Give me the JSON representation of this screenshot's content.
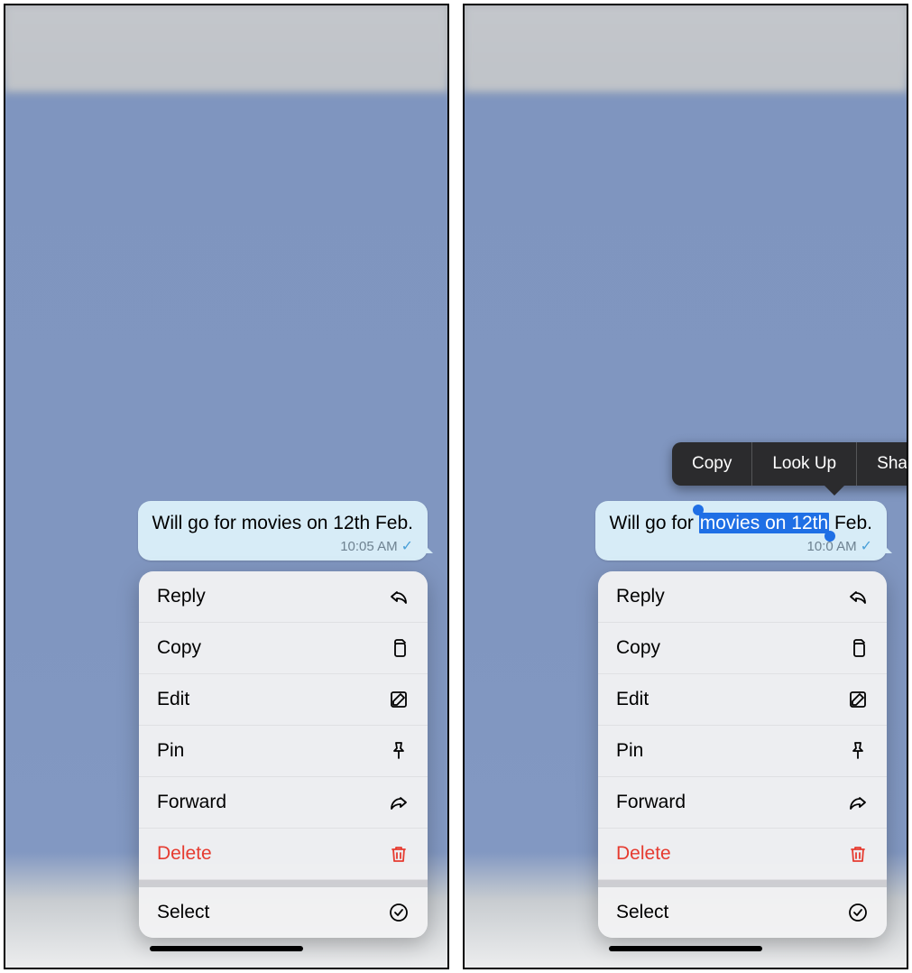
{
  "message": {
    "prefix": "Will go for ",
    "highlight": "movies on 12th",
    "suffix": " Feb.",
    "full": "Will go for movies on 12th Feb.",
    "time": "10:05 AM",
    "time_partial": "10:0   AM"
  },
  "menu": {
    "reply": "Reply",
    "copy": "Copy",
    "edit": "Edit",
    "pin": "Pin",
    "forward": "Forward",
    "delete": "Delete",
    "select": "Select"
  },
  "callout": {
    "copy": "Copy",
    "lookup": "Look Up",
    "share": "Share"
  },
  "icons": {
    "reply": "reply-arrow-icon",
    "copy": "documents-icon",
    "edit": "square-pencil-icon",
    "pin": "pin-icon",
    "forward": "share-arrow-icon",
    "delete": "trash-icon",
    "select": "check-circle-icon",
    "read": "checkmark-icon"
  }
}
